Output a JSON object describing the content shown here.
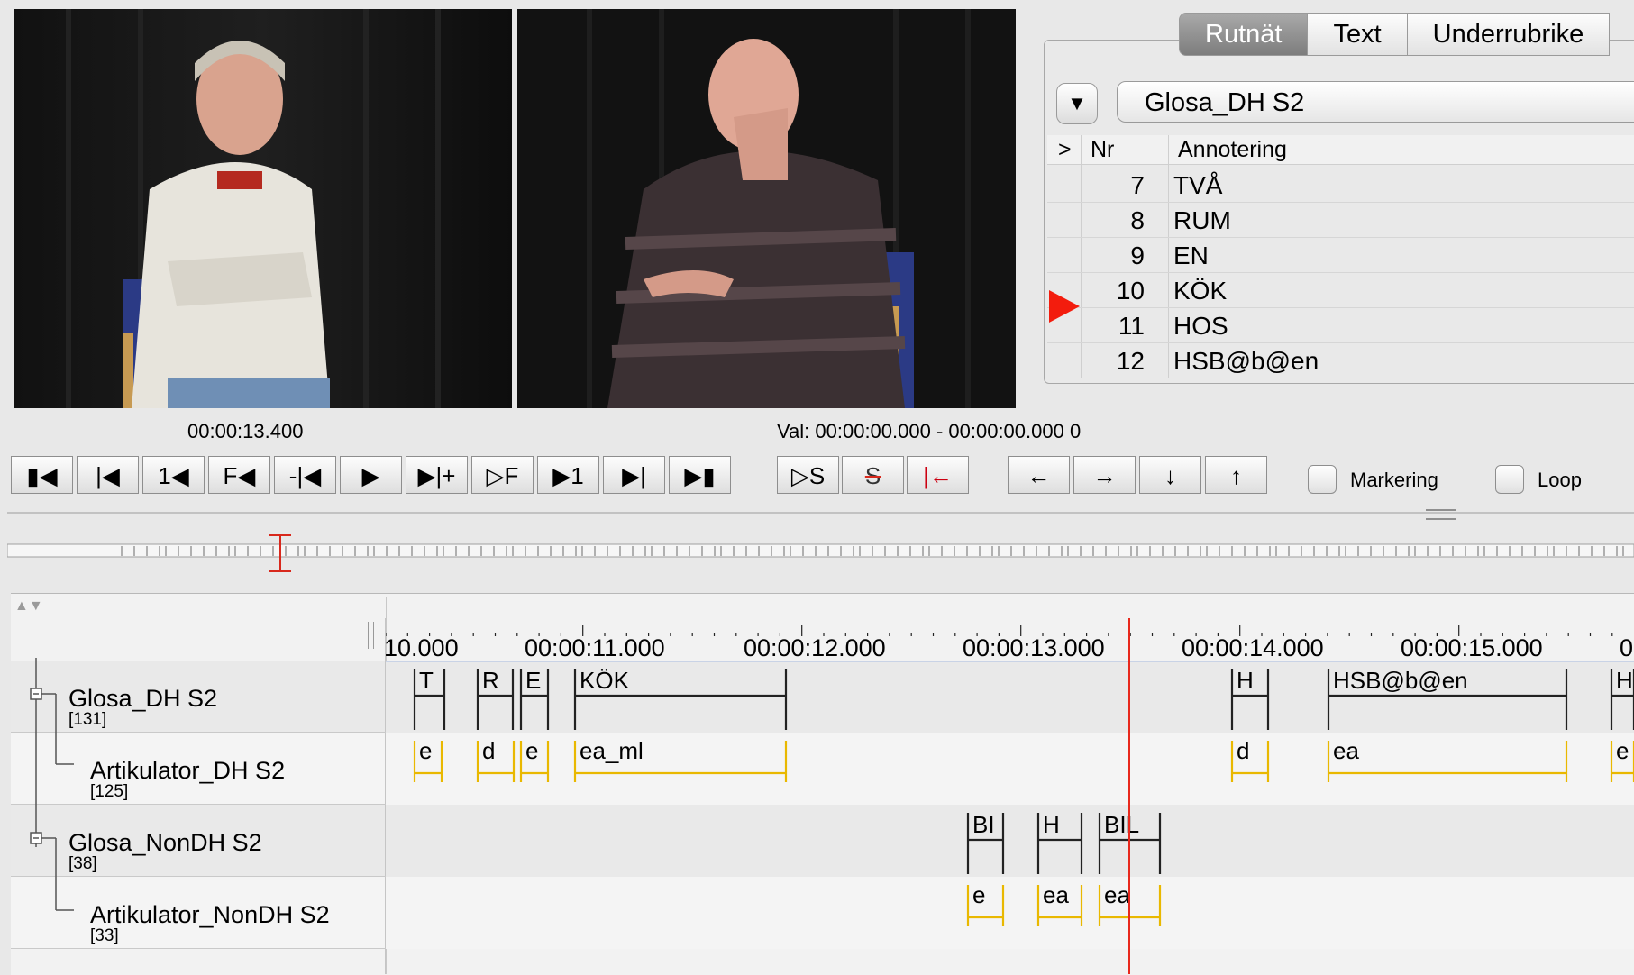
{
  "tabs": [
    {
      "label": "Rutnät",
      "active": true
    },
    {
      "label": "Text",
      "active": false
    },
    {
      "label": "Underrubrike",
      "active": false
    }
  ],
  "tier_selector": {
    "dropdown_icon": "triangle-down-icon",
    "value": "Glosa_DH S2"
  },
  "table": {
    "headers": {
      "marker": ">",
      "nr": "Nr",
      "annotation": "Annotering"
    },
    "rows": [
      {
        "nr": "7",
        "annotation": "TVÅ",
        "current": false
      },
      {
        "nr": "8",
        "annotation": "RUM",
        "current": false
      },
      {
        "nr": "9",
        "annotation": "EN",
        "current": false
      },
      {
        "nr": "10",
        "annotation": "KÖK",
        "current": true
      },
      {
        "nr": "11",
        "annotation": "HOS",
        "current": false
      },
      {
        "nr": "12",
        "annotation": "HSB@b@en",
        "current": false
      }
    ]
  },
  "player": {
    "current_time": "00:00:13.400",
    "selection": "Val: 00:00:00.000 - 00:00:00.000  0"
  },
  "transport_buttons": [
    {
      "glyph": "▮◀",
      "icon": "go-to-begin-icon"
    },
    {
      "glyph": "|◀",
      "icon": "previous-scrollview-icon"
    },
    {
      "glyph": "1◀",
      "icon": "previous-second-icon"
    },
    {
      "glyph": "F◀",
      "icon": "previous-frame-icon"
    },
    {
      "glyph": "-|◀",
      "icon": "previous-ms-icon"
    },
    {
      "glyph": "▶",
      "icon": "play-icon"
    },
    {
      "glyph": "▶|+",
      "icon": "next-ms-icon"
    },
    {
      "glyph": "▷F",
      "icon": "next-frame-icon"
    },
    {
      "glyph": "▶1",
      "icon": "next-second-icon"
    },
    {
      "glyph": "▶|",
      "icon": "next-scrollview-icon"
    },
    {
      "glyph": "▶▮",
      "icon": "go-to-end-icon"
    }
  ],
  "selection_buttons": [
    {
      "glyph": "▷S",
      "icon": "play-selection-icon"
    },
    {
      "glyph": "S",
      "icon": "clear-selection-icon"
    },
    {
      "glyph": "|←",
      "icon": "selection-begin-icon"
    }
  ],
  "nav_buttons": [
    {
      "glyph": "←",
      "icon": "arrow-left-icon"
    },
    {
      "glyph": "→",
      "icon": "arrow-right-icon"
    },
    {
      "glyph": "↓",
      "icon": "arrow-down-icon"
    },
    {
      "glyph": "↑",
      "icon": "arrow-up-icon"
    }
  ],
  "checkboxes": [
    {
      "label": "Markering",
      "checked": false
    },
    {
      "label": "Loop",
      "checked": false
    }
  ],
  "ruler": {
    "ticks": [
      "10.000",
      "00:00:11.000",
      "00:00:12.000",
      "00:00:13.000",
      "00:00:14.000",
      "00:00:15.000",
      "0"
    ]
  },
  "tiers": [
    {
      "name": "Glosa_DH S2",
      "count": "[131]"
    },
    {
      "name": "Artikulator_DH S2",
      "count": "[125]"
    },
    {
      "name": "Glosa_NonDH S2",
      "count": "[38]"
    },
    {
      "name": "Artikulator_NonDH S2",
      "count": "[33]"
    }
  ],
  "annotations": {
    "glosa_dh": [
      "T",
      "R",
      "E",
      "KÖK",
      "H",
      "HSB@b@en",
      "H"
    ],
    "artik_dh": [
      "e",
      "d",
      "e",
      "ea_ml",
      "d",
      "ea",
      "e"
    ],
    "glosa_nondh": [
      "BI",
      "H",
      "BIL"
    ],
    "artik_nondh": [
      "e",
      "ea",
      "ea"
    ]
  },
  "colors": {
    "crosshair": "#e8281c",
    "artikulator": "#e9b800",
    "tab_active": "#8a8a8a"
  }
}
